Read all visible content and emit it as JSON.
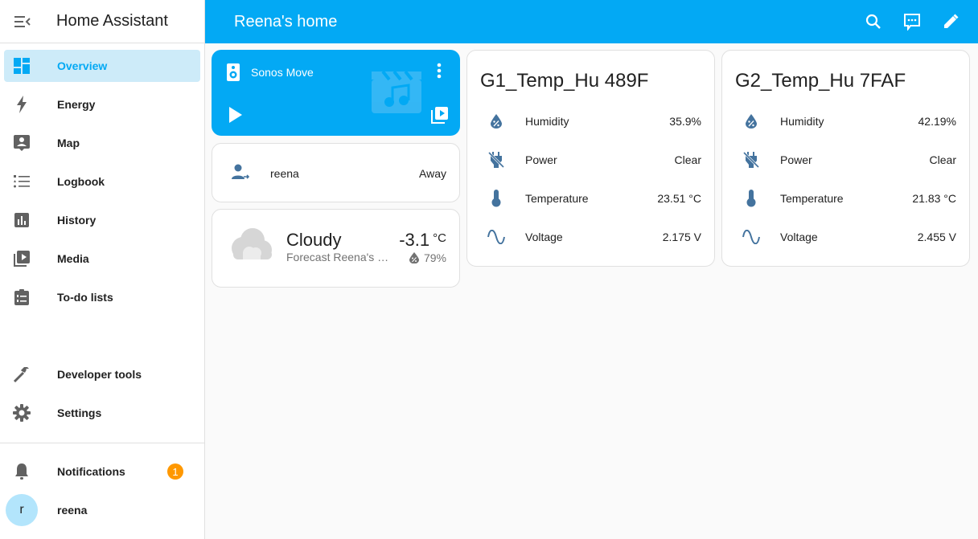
{
  "app": {
    "title": "Home Assistant"
  },
  "sidebar": {
    "items": [
      {
        "label": "Overview",
        "icon": "view-dashboard-icon",
        "active": true
      },
      {
        "label": "Energy",
        "icon": "lightning-bolt-icon"
      },
      {
        "label": "Map",
        "icon": "account-box-map-icon"
      },
      {
        "label": "Logbook",
        "icon": "format-list-bulleted-icon"
      },
      {
        "label": "History",
        "icon": "chart-box-icon"
      },
      {
        "label": "Media",
        "icon": "play-box-multiple-icon"
      },
      {
        "label": "To-do lists",
        "icon": "clipboard-list-icon"
      }
    ],
    "bottom_items": [
      {
        "label": "Developer tools",
        "icon": "hammer-icon"
      },
      {
        "label": "Settings",
        "icon": "cog-icon"
      }
    ],
    "notifications": {
      "label": "Notifications",
      "count": "1"
    },
    "user": {
      "initial": "r",
      "name": "reena"
    }
  },
  "topbar": {
    "title": "Reena's home",
    "actions": [
      "search-icon",
      "assist-icon",
      "edit-icon"
    ]
  },
  "colors": {
    "primary": "#03a9f4",
    "active_bg": "#cdebf9",
    "badge": "#ff9800",
    "state_icon": "#44739e"
  },
  "media_card": {
    "name": "Sonos Move"
  },
  "person_card": {
    "name": "reena",
    "state": "Away"
  },
  "weather_card": {
    "state": "Cloudy",
    "name": "Forecast Reena's home",
    "temperature": "-3.1",
    "unit": "°C",
    "humidity": "79%"
  },
  "entity_cards": [
    {
      "title": "G1_Temp_Hu 489F",
      "rows": [
        {
          "label": "Humidity",
          "value": "35.9%",
          "icon": "water-percent-icon"
        },
        {
          "label": "Power",
          "value": "Clear",
          "icon": "power-plug-off-icon"
        },
        {
          "label": "Temperature",
          "value": "23.51 °C",
          "icon": "thermometer-icon"
        },
        {
          "label": "Voltage",
          "value": "2.175 V",
          "icon": "sine-wave-icon"
        }
      ]
    },
    {
      "title": "G2_Temp_Hu 7FAF",
      "rows": [
        {
          "label": "Humidity",
          "value": "42.19%",
          "icon": "water-percent-icon"
        },
        {
          "label": "Power",
          "value": "Clear",
          "icon": "power-plug-off-icon"
        },
        {
          "label": "Temperature",
          "value": "21.83 °C",
          "icon": "thermometer-icon"
        },
        {
          "label": "Voltage",
          "value": "2.455 V",
          "icon": "sine-wave-icon"
        }
      ]
    }
  ]
}
